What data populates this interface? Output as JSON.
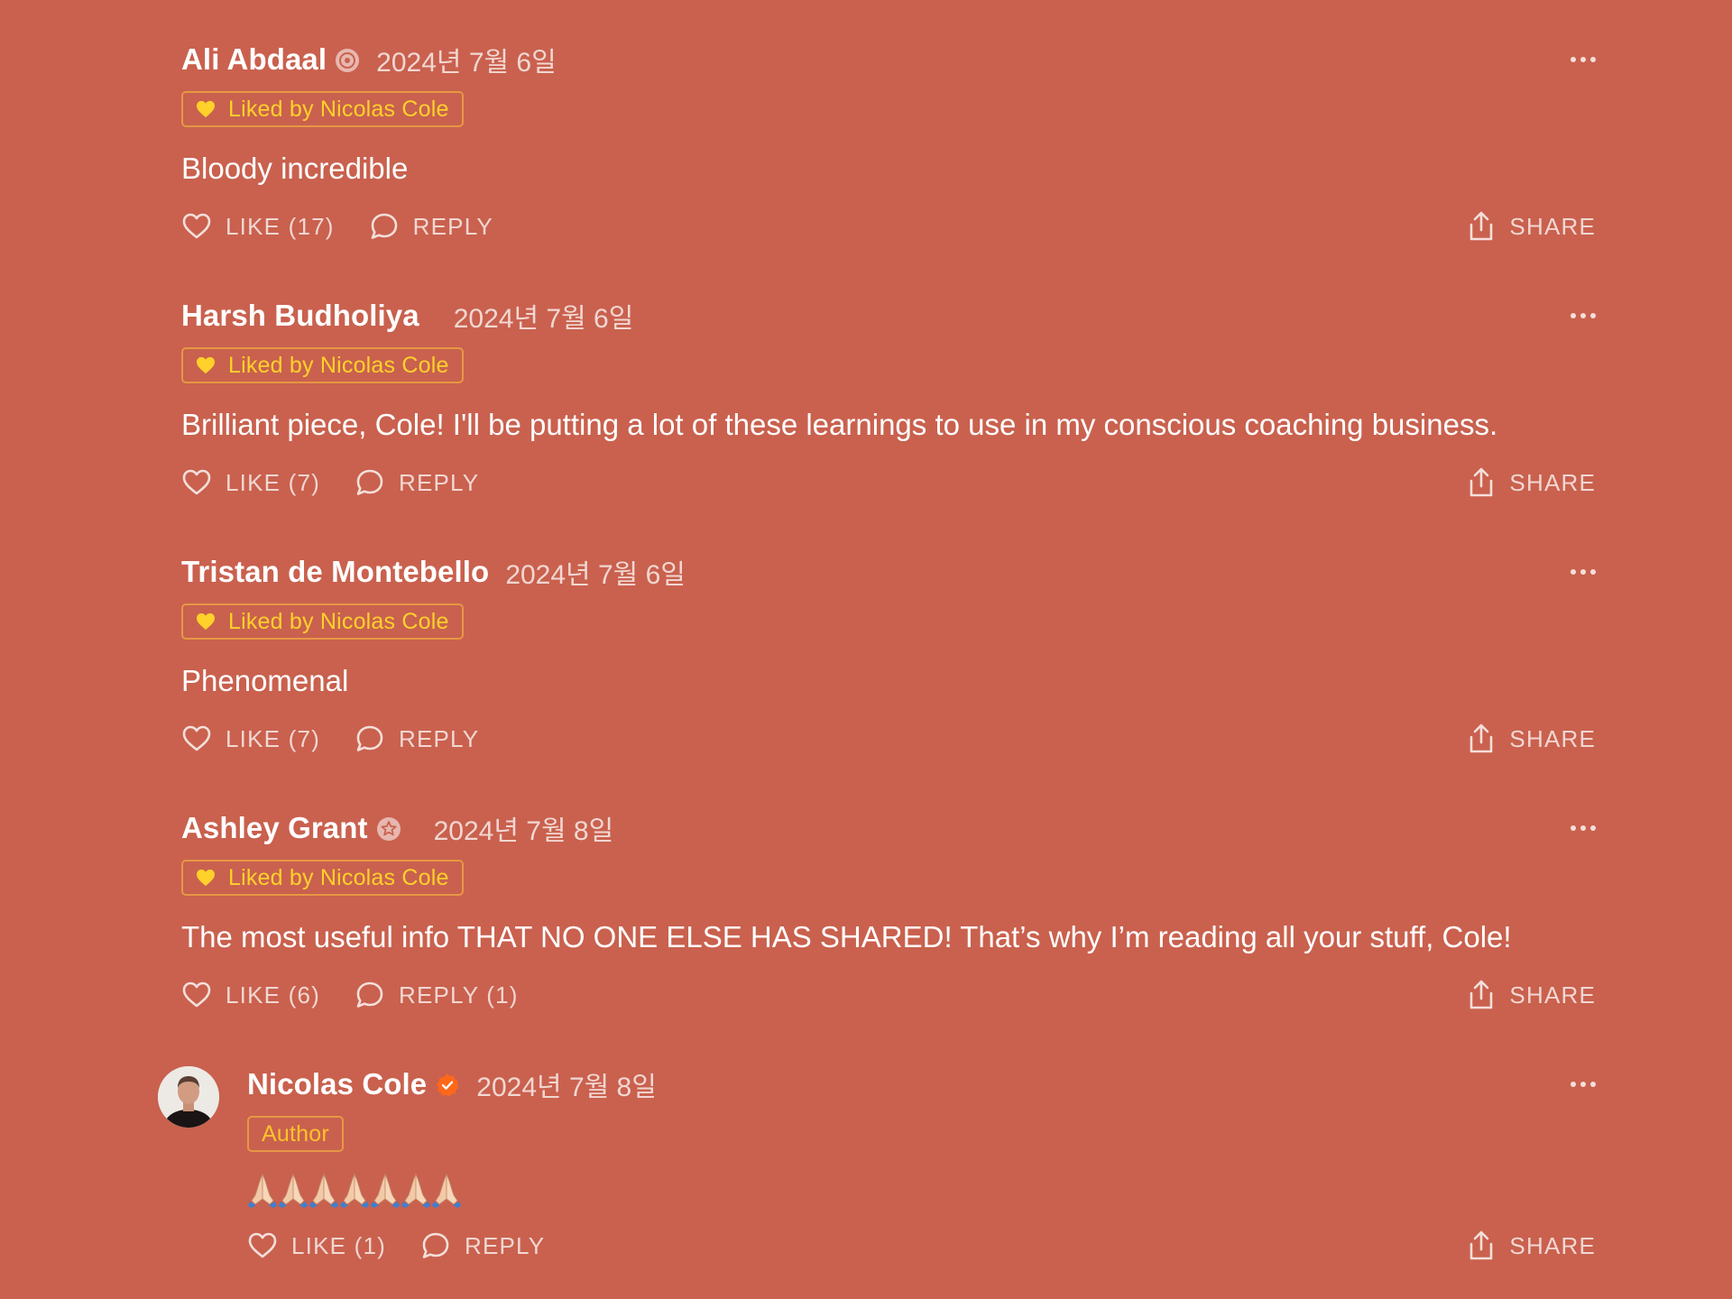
{
  "comments": [
    {
      "author": "Ali Abdaal",
      "date": "2024년 7월 6일",
      "liked_badge": "Liked by Nicolas Cole",
      "text": "Bloody incredible",
      "like_label": "LIKE (17)",
      "reply_label": "REPLY",
      "share_label": "SHARE"
    },
    {
      "author": "Harsh Budholiya",
      "date": "2024년 7월 6일",
      "liked_badge": "Liked by Nicolas Cole",
      "text": "Brilliant piece, Cole! I'll be putting a lot of these learnings to use in my conscious coaching business.",
      "like_label": "LIKE (7)",
      "reply_label": "REPLY",
      "share_label": "SHARE"
    },
    {
      "author": "Tristan de Montebello",
      "date": "2024년 7월 6일",
      "liked_badge": "Liked by Nicolas Cole",
      "text": "Phenomenal",
      "like_label": "LIKE (7)",
      "reply_label": "REPLY",
      "share_label": "SHARE"
    },
    {
      "author": "Ashley Grant",
      "date": "2024년 7월 8일",
      "liked_badge": "Liked by Nicolas Cole",
      "text": "The most useful info THAT NO ONE ELSE HAS SHARED! That’s why I’m reading all your stuff, Cole!",
      "like_label": "LIKE (6)",
      "reply_label": "REPLY (1)",
      "share_label": "SHARE"
    }
  ],
  "reply": {
    "author": "Nicolas Cole",
    "date": "2024년 7월 8일",
    "role_badge": "Author",
    "emoji_count": 7,
    "emoji_icon": "folded-hands-emoji",
    "like_label": "LIKE (1)",
    "reply_label": "REPLY",
    "share_label": "SHARE"
  },
  "colors": {
    "background": "#C9614E",
    "liked_text": "#FFD12A",
    "verified": "#FF6719"
  }
}
